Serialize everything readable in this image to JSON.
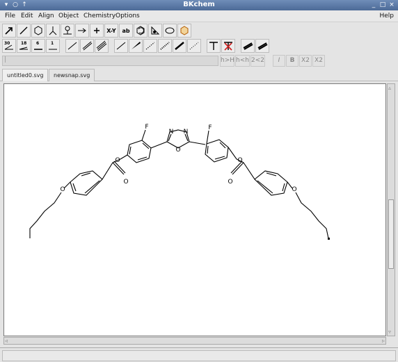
{
  "window": {
    "title": "BKchem"
  },
  "menu": {
    "items": [
      "File",
      "Edit",
      "Align",
      "Object",
      "Chemistry",
      "Options"
    ],
    "help": "Help"
  },
  "toolbar1": {
    "tools": [
      "arrow-tool",
      "line-tool",
      "ring-tool",
      "template-tool",
      "group-tool",
      "connect-tool",
      "atom-tool",
      "text-xy-tool",
      "text-ab-tool",
      "rotate-tool",
      "mark-tool",
      "oval-tool",
      "bio-tool"
    ],
    "labels": {
      "text_xy": "X-Y",
      "text_ab": "ab"
    }
  },
  "toolbar2": {
    "angle_labels": [
      "30",
      "18",
      "6",
      "1"
    ]
  },
  "format": {
    "buttons": [
      "h>H",
      "h<h",
      "2<2",
      "I",
      "B",
      "X2",
      "X2"
    ]
  },
  "tabs": [
    "untitled0.svg",
    "newsnap.svg"
  ],
  "molecule": {
    "atom_labels": [
      "F",
      "F",
      "N",
      "N",
      "O",
      "O",
      "O",
      "O",
      "O",
      "O",
      "O"
    ]
  }
}
